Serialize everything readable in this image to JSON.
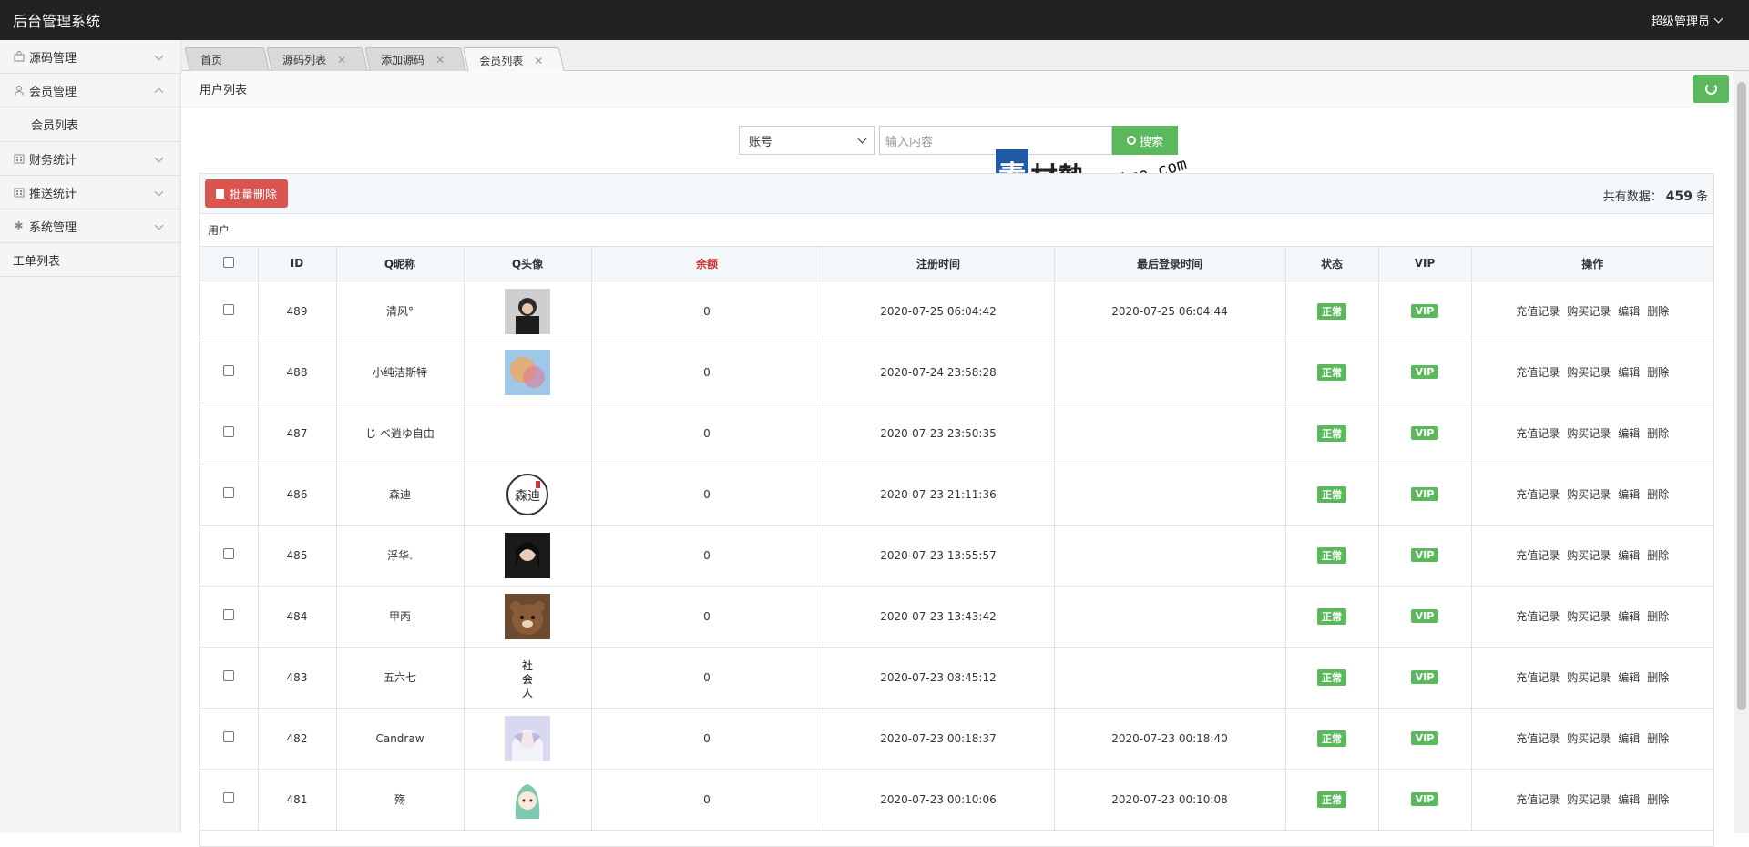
{
  "app": {
    "title": "后台管理系统",
    "user_menu": "超级管理员"
  },
  "sidebar": {
    "items": [
      {
        "label": "源码管理",
        "icon": "bag-icon",
        "expanded": false
      },
      {
        "label": "会员管理",
        "icon": "user-icon",
        "expanded": true
      },
      {
        "label": "会员列表",
        "sub": true
      },
      {
        "label": "财务统计",
        "icon": "building-icon",
        "expanded": false
      },
      {
        "label": "推送统计",
        "icon": "building-icon",
        "expanded": false
      },
      {
        "label": "系统管理",
        "icon": "gear-icon",
        "expanded": false
      },
      {
        "label": "工单列表",
        "plain": true
      }
    ]
  },
  "tabs": [
    {
      "label": "首页",
      "closable": false
    },
    {
      "label": "源码列表",
      "closable": true
    },
    {
      "label": "添加源码",
      "closable": true
    },
    {
      "label": "会员列表",
      "closable": true,
      "active": true
    }
  ],
  "breadcrumb": "用户列表",
  "search": {
    "field_selected": "账号",
    "placeholder": "输入内容",
    "button": "搜索"
  },
  "watermark": {
    "glyph": "素",
    "text": "材熱",
    "domain": "sucaire.com"
  },
  "toolbar": {
    "batch_delete": "批量删除",
    "count_label": "共有数据：",
    "count_value": "459",
    "count_unit": "条"
  },
  "table": {
    "caption": "用户",
    "headers": [
      "",
      "ID",
      "Q昵称",
      "Q头像",
      "余额",
      "注册时间",
      "最后登录时间",
      "状态",
      "VIP",
      "操作"
    ],
    "actions": [
      "充值记录",
      "购买记录",
      "编辑",
      "删除"
    ],
    "rows": [
      {
        "id": "489",
        "nick": "清风°",
        "balance": "0",
        "reg": "2020-07-25 06:04:42",
        "last": "2020-07-25 06:04:44",
        "status": "正常",
        "vip": "VIP",
        "avatar": "avatar-photo-girl"
      },
      {
        "id": "488",
        "nick": "小纯洁斯特",
        "balance": "0",
        "reg": "2020-07-24 23:58:28",
        "last": "",
        "status": "正常",
        "vip": "VIP",
        "avatar": "avatar-colorful"
      },
      {
        "id": "487",
        "nick": "じ べ逍ゆ自由",
        "balance": "0",
        "reg": "2020-07-23 23:50:35",
        "last": "",
        "status": "正常",
        "vip": "VIP",
        "avatar": ""
      },
      {
        "id": "486",
        "nick": "森迪",
        "balance": "0",
        "reg": "2020-07-23 21:11:36",
        "last": "",
        "status": "正常",
        "vip": "VIP",
        "avatar": "avatar-seal"
      },
      {
        "id": "485",
        "nick": "浮华.",
        "balance": "0",
        "reg": "2020-07-23 13:55:57",
        "last": "",
        "status": "正常",
        "vip": "VIP",
        "avatar": "avatar-photo-dark"
      },
      {
        "id": "484",
        "nick": "甲丙",
        "balance": "0",
        "reg": "2020-07-23 13:43:42",
        "last": "",
        "status": "正常",
        "vip": "VIP",
        "avatar": "avatar-bear"
      },
      {
        "id": "483",
        "nick": "五六七",
        "balance": "0",
        "reg": "2020-07-23 08:45:12",
        "last": "",
        "status": "正常",
        "vip": "VIP",
        "avatar": "avatar-calligraphy"
      },
      {
        "id": "482",
        "nick": "Candraw",
        "balance": "0",
        "reg": "2020-07-23 00:18:37",
        "last": "2020-07-23 00:18:40",
        "status": "正常",
        "vip": "VIP",
        "avatar": "avatar-anime"
      },
      {
        "id": "481",
        "nick": "殇",
        "balance": "0",
        "reg": "2020-07-23 00:10:06",
        "last": "2020-07-23 00:10:08",
        "status": "正常",
        "vip": "VIP",
        "avatar": "avatar-cartoon"
      }
    ]
  },
  "colors": {
    "topbar": "#222222",
    "success": "#5cb85c",
    "danger": "#d9534f",
    "balance_header": "#c9302c"
  }
}
